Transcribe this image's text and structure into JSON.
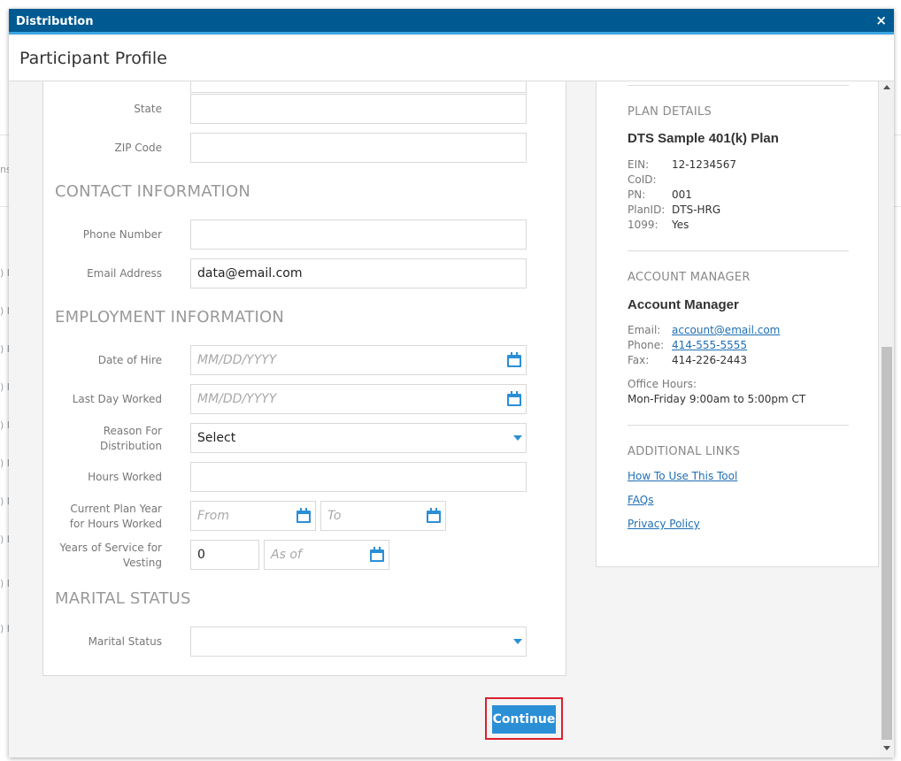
{
  "window": {
    "title": "Distribution",
    "close_glyph": "×"
  },
  "header": {
    "title": "Participant Profile"
  },
  "background_fragments": [
    "ns",
    ") I",
    ") I",
    ") I",
    ") I",
    ") I",
    ") I",
    ") I",
    ") I",
    ") I",
    ") I",
    ") I"
  ],
  "form": {
    "address": {
      "state_label": "State",
      "state_value": "",
      "zip_label": "ZIP Code",
      "zip_value": ""
    },
    "contact": {
      "title": "CONTACT INFORMATION",
      "phone_label": "Phone Number",
      "phone_value": "",
      "email_label": "Email Address",
      "email_value": "data@email.com"
    },
    "employment": {
      "title": "EMPLOYMENT INFORMATION",
      "hire_label": "Date of Hire",
      "hire_placeholder": "MM/DD/YYYY",
      "lastday_label": "Last Day Worked",
      "lastday_placeholder": "MM/DD/YYYY",
      "reason_label_1": "Reason For",
      "reason_label_2": "Distribution",
      "reason_value": "Select",
      "hours_label": "Hours Worked",
      "hours_value": "",
      "planyear_label_1": "Current Plan Year",
      "planyear_label_2": "for Hours Worked",
      "from_placeholder": "From",
      "to_placeholder": "To",
      "years_label_1": "Years of Service for",
      "years_label_2": "Vesting",
      "years_value": "0",
      "asof_placeholder": "As of"
    },
    "marital": {
      "title": "MARITAL STATUS",
      "label": "Marital Status",
      "value": ""
    }
  },
  "sidebar": {
    "plan": {
      "heading": "PLAN DETAILS",
      "name": "DTS Sample 401(k) Plan",
      "rows": [
        {
          "key": "EIN:",
          "value": "12-1234567"
        },
        {
          "key": "CoID:",
          "value": ""
        },
        {
          "key": "PN:",
          "value": "001"
        },
        {
          "key": "PlanID:",
          "value": "DTS-HRG"
        },
        {
          "key": "1099:",
          "value": "Yes"
        }
      ]
    },
    "manager": {
      "heading": "ACCOUNT MANAGER",
      "name": "Account Manager",
      "email_key": "Email:",
      "email": "account@email.com",
      "phone_key": "Phone:",
      "phone": "414-555-5555",
      "fax_key": "Fax:",
      "fax": "414-226-2443",
      "hours_label": "Office Hours:",
      "hours": "Mon-Friday 9:00am to 5:00pm CT"
    },
    "links": {
      "heading": "ADDITIONAL LINKS",
      "items": [
        "How To Use This Tool",
        "FAQs",
        "Privacy Policy"
      ]
    }
  },
  "actions": {
    "continue_label": "Continue"
  },
  "colors": {
    "titlebar": "#005a92",
    "accent": "#2b8fd6",
    "highlight": "#d9212c"
  }
}
